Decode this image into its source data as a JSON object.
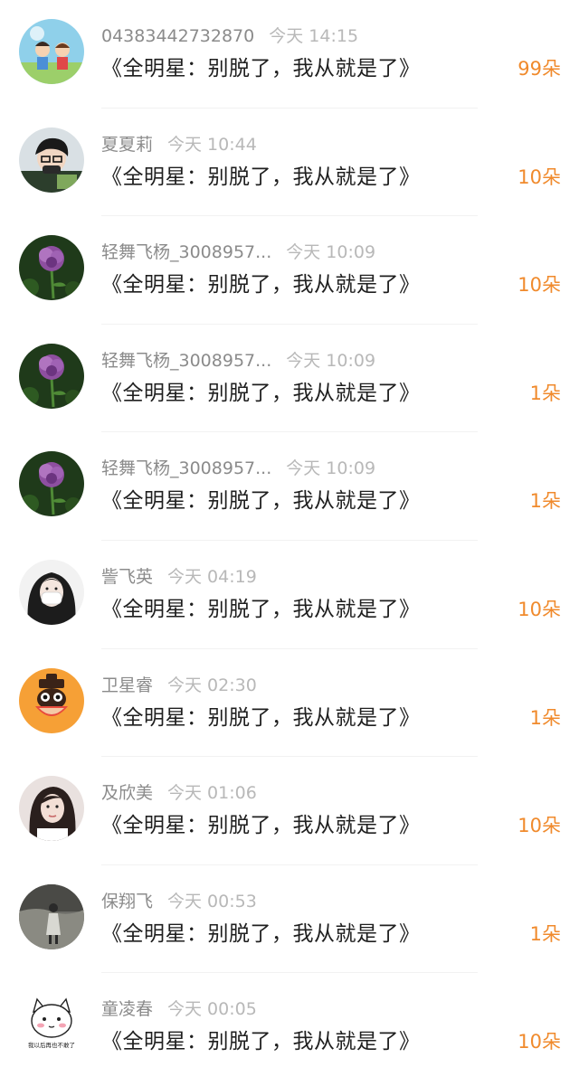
{
  "gifts": [
    {
      "name": "04383442732870",
      "time": "今天 14:15",
      "title": "《全明星：别脱了，我从就是了》",
      "count": "99朵",
      "avatar": "anime-kids-avatar"
    },
    {
      "name": "夏夏莉",
      "time": "今天 10:44",
      "title": "《全明星：别脱了，我从就是了》",
      "count": "10朵",
      "avatar": "boy-glasses-avatar"
    },
    {
      "name": "轻舞飞杨_3008957...",
      "time": "今天 10:09",
      "title": "《全明星：别脱了，我从就是了》",
      "count": "10朵",
      "avatar": "purple-rose-avatar"
    },
    {
      "name": "轻舞飞杨_3008957...",
      "time": "今天 10:09",
      "title": "《全明星：别脱了，我从就是了》",
      "count": "1朵",
      "avatar": "purple-rose-avatar"
    },
    {
      "name": "轻舞飞杨_3008957...",
      "time": "今天 10:09",
      "title": "《全明星：别脱了，我从就是了》",
      "count": "1朵",
      "avatar": "purple-rose-avatar"
    },
    {
      "name": "訾飞英",
      "time": "今天 04:19",
      "title": "《全明星：别脱了，我从就是了》",
      "count": "10朵",
      "avatar": "girl-mask-avatar"
    },
    {
      "name": "卫星睿",
      "time": "今天 02:30",
      "title": "《全明星：别脱了，我从就是了》",
      "count": "1朵",
      "avatar": "monkey-cartoon-avatar"
    },
    {
      "name": "及欣美",
      "time": "今天 01:06",
      "title": "《全明星：别脱了，我从就是了》",
      "count": "10朵",
      "avatar": "girl-portrait-avatar"
    },
    {
      "name": "保翔飞",
      "time": "今天 00:53",
      "title": "《全明星：别脱了，我从就是了》",
      "count": "1朵",
      "avatar": "dark-figure-avatar"
    },
    {
      "name": "童凌春",
      "time": "今天 00:05",
      "title": "《全明星：别脱了，我从就是了》",
      "count": "10朵",
      "avatar": "cat-cartoon-avatar",
      "avatar_text": "我以后再也不敢了"
    }
  ],
  "colors": {
    "count": "#f08a2c",
    "title": "#1f1f1f",
    "name": "#8b8b8b",
    "time": "#b8b8b8",
    "divider": "#f2f2f2"
  }
}
